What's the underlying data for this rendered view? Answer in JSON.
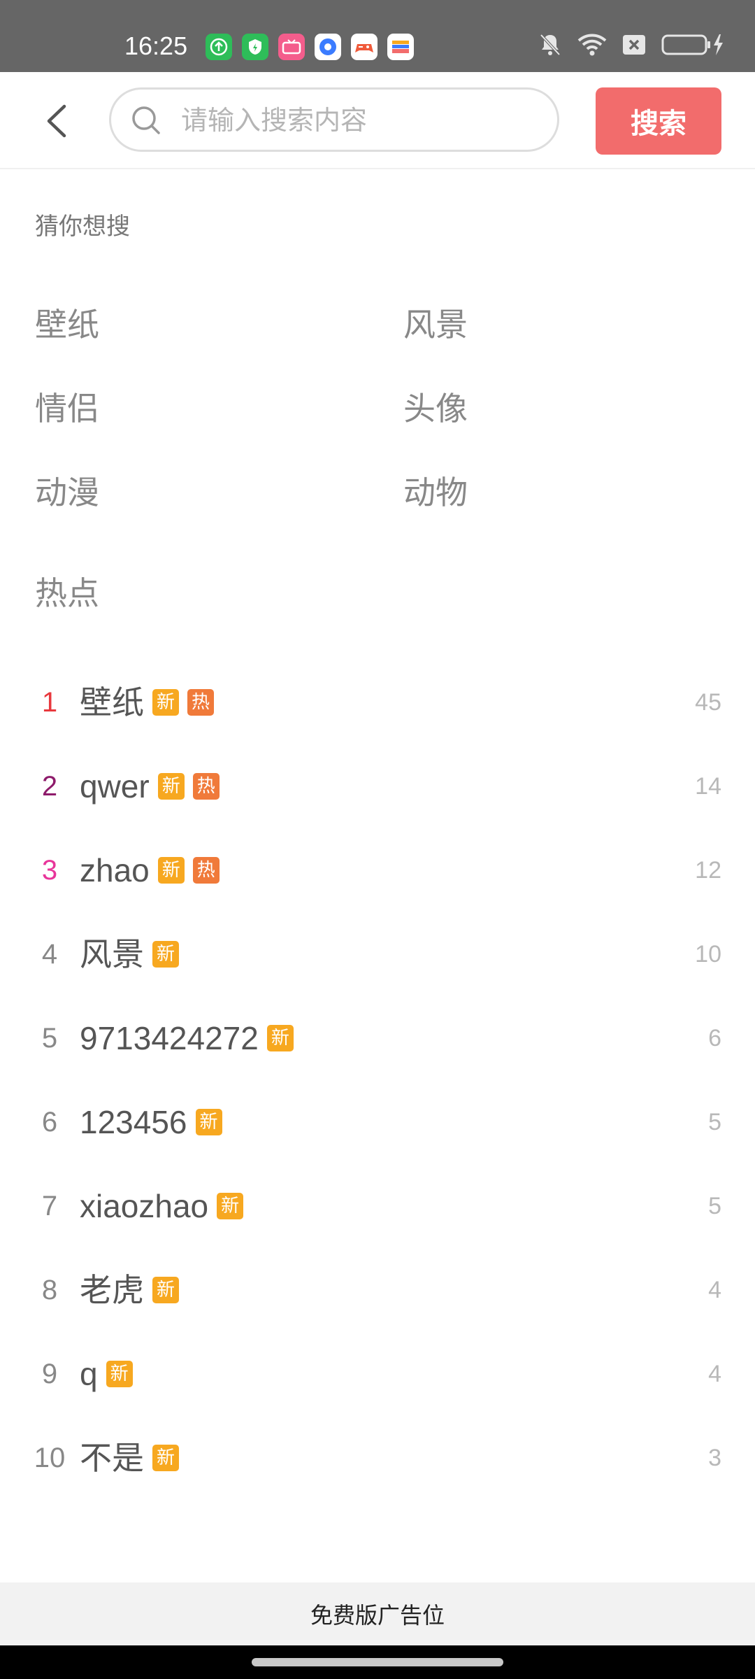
{
  "status_bar": {
    "time": "16:25",
    "apps": [
      {
        "icon": "upload-app-icon",
        "color": "#2ebd59"
      },
      {
        "icon": "shield-app-icon",
        "color": "#2ebd59"
      },
      {
        "icon": "bilibili-app-icon",
        "color": "#f45d8c"
      },
      {
        "icon": "ring-app-icon",
        "color": "#3b7cff"
      },
      {
        "icon": "game-app-icon",
        "color": "#ffffff"
      },
      {
        "icon": "wallet-app-icon",
        "color": "#ffffff"
      }
    ]
  },
  "header": {
    "search_placeholder": "请输入搜索内容",
    "search_button": "搜索"
  },
  "suggest": {
    "title": "猜你想搜",
    "items": [
      "壁纸",
      "风景",
      "情侣",
      "头像",
      "动漫",
      "动物"
    ]
  },
  "hot": {
    "title": "热点",
    "items": [
      {
        "rank": "1",
        "term": "壁纸",
        "new": "新",
        "hot": "热",
        "count": "45",
        "rank_color": "#e8383d"
      },
      {
        "rank": "2",
        "term": "qwer",
        "new": "新",
        "hot": "热",
        "count": "14",
        "rank_color": "#8e1b6b"
      },
      {
        "rank": "3",
        "term": "zhao",
        "new": "新",
        "hot": "热",
        "count": "12",
        "rank_color": "#e8359a"
      },
      {
        "rank": "4",
        "term": "风景",
        "new": "新",
        "count": "10"
      },
      {
        "rank": "5",
        "term": "9713424272",
        "new": "新",
        "count": "6"
      },
      {
        "rank": "6",
        "term": "123456",
        "new": "新",
        "count": "5"
      },
      {
        "rank": "7",
        "term": "xiaozhao",
        "new": "新",
        "count": "5"
      },
      {
        "rank": "8",
        "term": "老虎",
        "new": "新",
        "count": "4"
      },
      {
        "rank": "9",
        "term": "q",
        "new": "新",
        "count": "4"
      },
      {
        "rank": "10",
        "term": "不是",
        "new": "新",
        "count": "3"
      }
    ]
  },
  "ad": {
    "text": "免费版广告位"
  }
}
